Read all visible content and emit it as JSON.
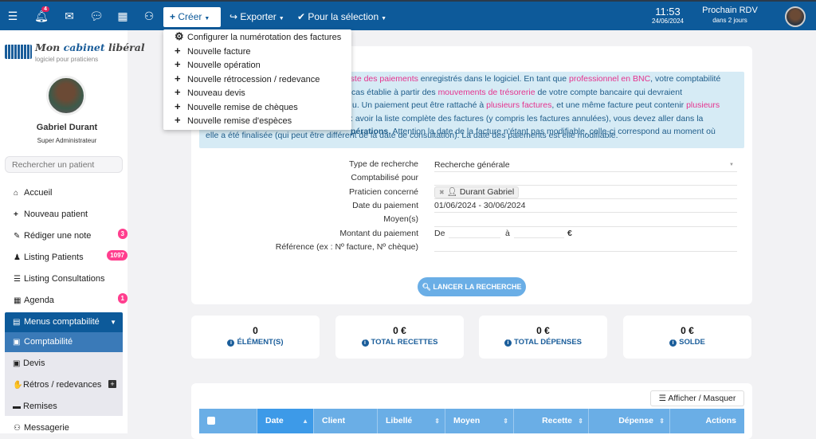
{
  "topbar": {
    "notification_count": "4",
    "create_label": "Créer",
    "export_label": "Exporter",
    "selection_label": "Pour la sélection",
    "time": "11:53",
    "date": "24/06/2024",
    "next_appt_title": "Prochain RDV",
    "next_appt_when": "dans 2 jours"
  },
  "create_menu": [
    {
      "icon": "gears-icon",
      "label": "Configurer la numérotation des factures"
    },
    {
      "icon": "plus-icon",
      "label": "Nouvelle facture"
    },
    {
      "icon": "plus-icon",
      "label": "Nouvelle opération"
    },
    {
      "icon": "plus-icon",
      "label": "Nouvelle rétrocession / redevance"
    },
    {
      "icon": "plus-icon",
      "label": "Nouveau devis"
    },
    {
      "icon": "plus-icon",
      "label": "Nouvelle remise de chèques"
    },
    {
      "icon": "plus-icon",
      "label": "Nouvelle remise d'espèces"
    }
  ],
  "brand": {
    "name_a": "Mon ",
    "name_b": "cabinet",
    "name_c": " libéral",
    "tagline": "logiciel pour praticiens"
  },
  "user": {
    "name": "Gabriel Durant",
    "role": "Super Administrateur"
  },
  "sidebar": {
    "search_placeholder": "Rechercher un patient",
    "items": [
      {
        "label": "Accueil"
      },
      {
        "label": "Nouveau patient"
      },
      {
        "label": "Rédiger une note",
        "badge": "3"
      },
      {
        "label": "Listing Patients",
        "badge": "1097"
      },
      {
        "label": "Listing Consultations"
      },
      {
        "label": "Agenda",
        "badge": "1"
      },
      {
        "label": "Menus comptabilité"
      },
      {
        "label": "Comptabilité"
      },
      {
        "label": "Devis"
      },
      {
        "label": "Rétros / redevances"
      },
      {
        "label": "Remises"
      },
      {
        "label": "Messagerie"
      }
    ]
  },
  "info": {
    "l1a": "liste des paiements",
    "l1b": " enregistrés dans le logiciel. En tant que ",
    "l1c": "professionnel en BNC",
    "l1d": ", votre comptabilité",
    "l2a": "cas établie à partir des ",
    "l2b": "mouvements de trésorerie",
    "l2c": " de votre compte bancaire qui devraient",
    "l3a": "u. Un paiement peut être rattaché à ",
    "l3b": "plusieurs factures",
    "l3c": ", et une même facture peut contenir ",
    "l3d": "plusieurs",
    "l4": ": avoir la liste complète des factures (y compris les factures annulées), vous devez aller dans la",
    "l5a": "pérations",
    "l5b": ". Attention la date de la facture n'étant pas modifiable, celle-ci correspond au moment où",
    "l6": "elle a été finalisée (qui peut être différent de la date de consultation). La date des paiements est elle modifiable."
  },
  "form": {
    "type_label": "Type de recherche",
    "type_value": "Recherche générale",
    "compta_label": "Comptabilisé pour",
    "praticien_label": "Praticien concerné",
    "praticien_value": "Durant Gabriel",
    "date_label": "Date du paiement",
    "date_value": "01/06/2024 - 30/06/2024",
    "moyen_label": "Moyen(s)",
    "montant_label": "Montant du paiement",
    "de": "De",
    "a": "à",
    "currency": "€",
    "ref_label": "Référence (ex : Nº facture, Nº chèque)",
    "search_button": "LANCER LA RECHERCHE"
  },
  "stats": [
    {
      "value": "0",
      "label": "ÉLÉMENT(S)"
    },
    {
      "value": "0 €",
      "label": "TOTAL RECETTES"
    },
    {
      "value": "0 €",
      "label": "TOTAL DÉPENSES"
    },
    {
      "value": "0 €",
      "label": "SOLDE"
    }
  ],
  "table": {
    "toggle_label": "Afficher / Masquer",
    "columns": [
      "Date",
      "Client",
      "Libellé",
      "Moyen",
      "Recette",
      "Dépense",
      "Actions"
    ]
  },
  "colors": {
    "primary": "#0d5a9a",
    "accent": "#e5338e",
    "header": "#6aaee6"
  }
}
